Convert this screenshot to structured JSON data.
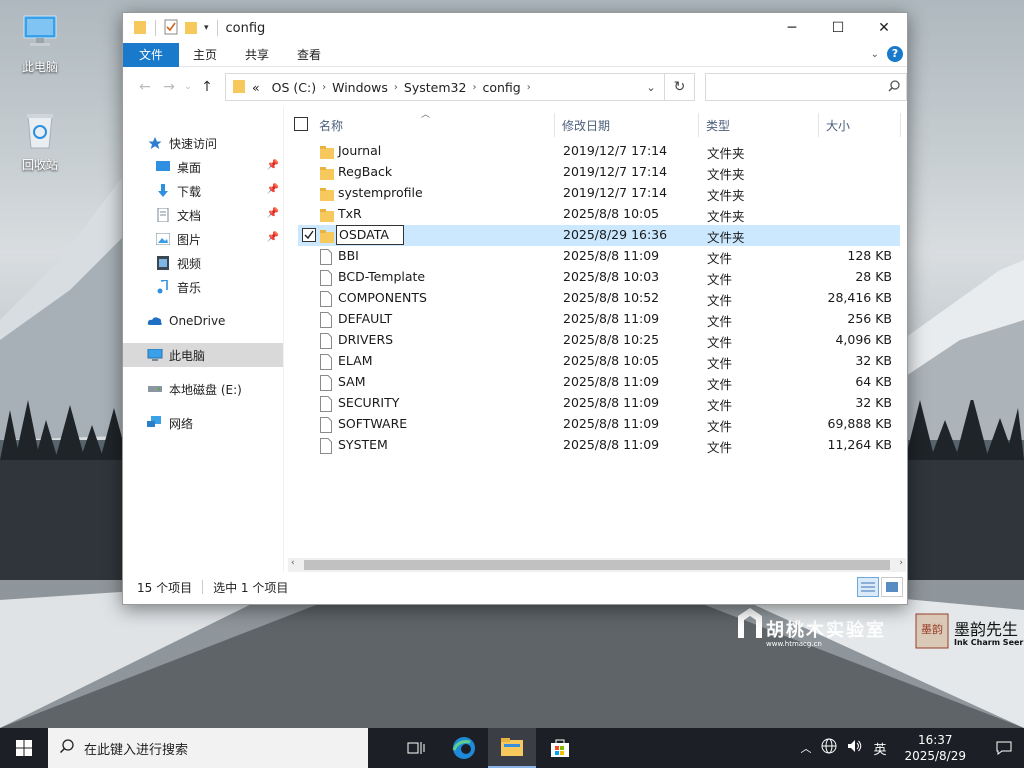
{
  "desktop": {
    "icons": [
      {
        "label": "此电脑",
        "icon": "computer-icon"
      },
      {
        "label": "回收站",
        "icon": "recycle-bin-icon"
      }
    ],
    "watermark": {
      "brand_cn": "胡桃木实验室",
      "brand_url": "www.htmacg.cn",
      "seal_text": "墨韵",
      "brand2_cn": "墨韵先生",
      "brand2_en": "Ink Charm Seer"
    }
  },
  "window": {
    "title": "config",
    "controls": {
      "minimize": "─",
      "maximize": "☐",
      "close": "✕"
    },
    "ribbon_tabs": [
      "文件",
      "主页",
      "共享",
      "查看"
    ],
    "address": {
      "prefix": "«",
      "crumbs": [
        "OS (C:)",
        "Windows",
        "System32",
        "config"
      ]
    },
    "search": {
      "placeholder": ""
    },
    "nav": [
      {
        "label": "快速访问",
        "icon": "star-icon",
        "pinned": false
      },
      {
        "label": "桌面",
        "icon": "desktop-icon",
        "pinned": true
      },
      {
        "label": "下载",
        "icon": "download-icon",
        "pinned": true
      },
      {
        "label": "文档",
        "icon": "document-icon",
        "pinned": true
      },
      {
        "label": "图片",
        "icon": "pictures-icon",
        "pinned": true
      },
      {
        "label": "视频",
        "icon": "video-icon",
        "pinned": false
      },
      {
        "label": "音乐",
        "icon": "music-icon",
        "pinned": false
      },
      {
        "label": "OneDrive",
        "icon": "onedrive-icon",
        "pinned": false
      },
      {
        "label": "此电脑",
        "icon": "this-pc-icon",
        "pinned": false,
        "selected": true
      },
      {
        "label": "本地磁盘 (E:)",
        "icon": "drive-icon",
        "pinned": false
      },
      {
        "label": "网络",
        "icon": "network-icon",
        "pinned": false
      }
    ],
    "columns": {
      "name": "名称",
      "date": "修改日期",
      "type": "类型",
      "size": "大小"
    },
    "files": [
      {
        "name": "Journal",
        "date": "2019/12/7 17:14",
        "type": "文件夹",
        "size": "",
        "kind": "folder"
      },
      {
        "name": "RegBack",
        "date": "2019/12/7 17:14",
        "type": "文件夹",
        "size": "",
        "kind": "folder"
      },
      {
        "name": "systemprofile",
        "date": "2019/12/7 17:14",
        "type": "文件夹",
        "size": "",
        "kind": "folder"
      },
      {
        "name": "TxR",
        "date": "2025/8/8 10:05",
        "type": "文件夹",
        "size": "",
        "kind": "folder"
      },
      {
        "name": "OSDATA",
        "date": "2025/8/29 16:36",
        "type": "文件夹",
        "size": "",
        "kind": "folder",
        "selected": true,
        "renaming": true
      },
      {
        "name": "BBI",
        "date": "2025/8/8 11:09",
        "type": "文件",
        "size": "128 KB",
        "kind": "file"
      },
      {
        "name": "BCD-Template",
        "date": "2025/8/8 10:03",
        "type": "文件",
        "size": "28 KB",
        "kind": "file"
      },
      {
        "name": "COMPONENTS",
        "date": "2025/8/8 10:52",
        "type": "文件",
        "size": "28,416 KB",
        "kind": "file"
      },
      {
        "name": "DEFAULT",
        "date": "2025/8/8 11:09",
        "type": "文件",
        "size": "256 KB",
        "kind": "file"
      },
      {
        "name": "DRIVERS",
        "date": "2025/8/8 10:25",
        "type": "文件",
        "size": "4,096 KB",
        "kind": "file"
      },
      {
        "name": "ELAM",
        "date": "2025/8/8 10:05",
        "type": "文件",
        "size": "32 KB",
        "kind": "file"
      },
      {
        "name": "SAM",
        "date": "2025/8/8 11:09",
        "type": "文件",
        "size": "64 KB",
        "kind": "file"
      },
      {
        "name": "SECURITY",
        "date": "2025/8/8 11:09",
        "type": "文件",
        "size": "32 KB",
        "kind": "file"
      },
      {
        "name": "SOFTWARE",
        "date": "2025/8/8 11:09",
        "type": "文件",
        "size": "69,888 KB",
        "kind": "file"
      },
      {
        "name": "SYSTEM",
        "date": "2025/8/8 11:09",
        "type": "文件",
        "size": "11,264 KB",
        "kind": "file"
      }
    ],
    "status": {
      "count": "15 个项目",
      "selected": "选中 1 个项目"
    }
  },
  "taskbar": {
    "search_placeholder": "在此键入进行搜索",
    "ime": "英",
    "time": "16:37",
    "date": "2025/8/29"
  },
  "colors": {
    "accent": "#1979ca",
    "selected_row": "#cce8ff",
    "taskbar": "#1c2026"
  }
}
